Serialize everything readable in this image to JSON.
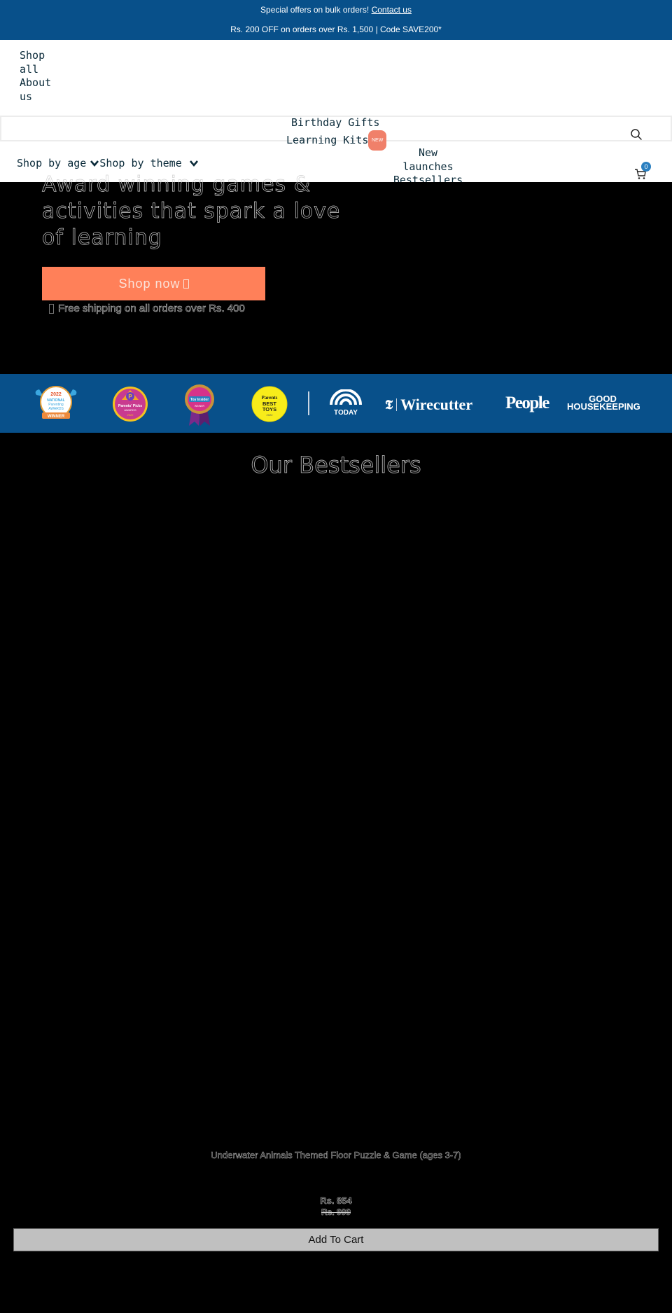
{
  "announcement": {
    "line1_text": "Special offers on bulk orders!",
    "line1_link": "Contact us",
    "line2_text": "Rs. 200 OFF on orders over Rs. 1,500 | Code SAVE200*"
  },
  "header": {
    "top_links": [
      "Shop all",
      "About us"
    ],
    "nav_center": [
      {
        "label": "Birthday Gifts"
      },
      {
        "label": "Learning Kits",
        "badge": "NEW"
      }
    ],
    "nav_dropdowns": [
      {
        "label": "Shop by age"
      },
      {
        "label": "Shop by theme"
      }
    ],
    "nav_right": [
      "New launches",
      "Bestsellers"
    ],
    "cart_count": "0",
    "icons": {
      "search": "search-icon",
      "cart": "cart-icon",
      "chevron": "chevron-down-icon"
    }
  },
  "hero": {
    "title": "Award winning games & activities that spark a love of learning",
    "cta_label": "Shop now",
    "shipping_note": "Free shipping on all orders over Rs. 400"
  },
  "awards": {
    "badges": [
      {
        "name": "National Parenting Product Awards",
        "year": "2022",
        "label": "WINNER"
      },
      {
        "name": "Parents' Picks Awards",
        "year": "2022"
      },
      {
        "name": "Toy Insider",
        "label": "WINNER"
      },
      {
        "name": "Parents Best Toys",
        "year": "2022"
      }
    ],
    "press": [
      "TODAY",
      "Wirecutter",
      "People",
      "GOOD HOUSEKEEPING"
    ]
  },
  "bestsellers": {
    "title": "Our Bestsellers",
    "product": {
      "name": "Underwater Animals Themed Floor Puzzle & Game (ages 3-7)",
      "price": "Rs. 854",
      "compare_price": "Rs. 999",
      "button_label": "Add To Cart"
    }
  },
  "colors": {
    "brand_blue": "#08508a",
    "cta_orange": "#ff8059",
    "badge_orange": "#f0806a",
    "cart_badge": "#2a7fc0",
    "nav_text": "#0b2b3a"
  }
}
